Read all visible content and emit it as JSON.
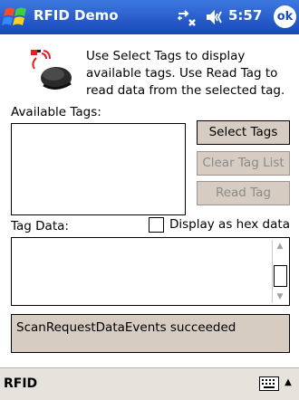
{
  "window": {
    "title": "RFID Demo",
    "clock": "5:57",
    "ok_label": "ok"
  },
  "intro": {
    "instructions": "Use Select Tags to display available tags.  Use Read Tag to read data from the selected tag."
  },
  "available_tags": {
    "label": "Available Tags:",
    "items": []
  },
  "buttons": {
    "select_tags": "Select Tags",
    "clear_tag_list": "Clear Tag List",
    "read_tag": "Read Tag"
  },
  "tag_data": {
    "label": "Tag Data:",
    "hex_checkbox_label": "Display as hex data",
    "hex_checked": false,
    "value": ""
  },
  "status": {
    "message": "ScanRequestDataEvents succeeded"
  },
  "bottom_bar": {
    "label": "RFID"
  },
  "icons": {
    "start": "windows-start-icon",
    "connectivity": "connectivity-icon",
    "volume": "volume-icon",
    "reader": "rfid-reader-icon",
    "keyboard": "keyboard-icon",
    "sip_arrow": "up-arrow-icon"
  }
}
